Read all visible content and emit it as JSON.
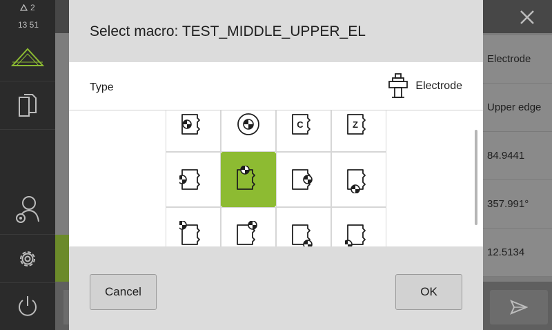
{
  "status": {
    "message_count": "2",
    "time": "13 51"
  },
  "sidebar": {
    "items": [
      {
        "name": "measure",
        "icon": "measure-triangle-icon"
      },
      {
        "name": "documents",
        "icon": "documents-icon"
      },
      {
        "name": "user",
        "icon": "user-settings-icon"
      },
      {
        "name": "settings",
        "icon": "gear-icon"
      },
      {
        "name": "power",
        "icon": "power-icon"
      }
    ]
  },
  "background": {
    "rows": [
      "Electrode",
      "Upper edge",
      "84.9441",
      "357.991°",
      "12.5134"
    ]
  },
  "dialog": {
    "title": "Select macro: TEST_MIDDLE_UPPER_EL",
    "type_label": "Type",
    "tool_label": "Electrode",
    "macros": [
      {
        "row": 0,
        "col": 0,
        "kind": "target-inside-left"
      },
      {
        "row": 0,
        "col": 1,
        "kind": "target-center"
      },
      {
        "row": 0,
        "col": 2,
        "kind": "text",
        "label": "C"
      },
      {
        "row": 0,
        "col": 3,
        "kind": "text",
        "label": "Z"
      },
      {
        "row": 1,
        "col": 0,
        "kind": "target-left-middle"
      },
      {
        "row": 1,
        "col": 1,
        "kind": "target-top-middle",
        "selected": true
      },
      {
        "row": 1,
        "col": 2,
        "kind": "target-right-middle"
      },
      {
        "row": 1,
        "col": 3,
        "kind": "target-bottom-left"
      },
      {
        "row": 2,
        "col": 0,
        "kind": "target-top-left"
      },
      {
        "row": 2,
        "col": 1,
        "kind": "target-top-right"
      },
      {
        "row": 2,
        "col": 2,
        "kind": "target-bottom-right"
      },
      {
        "row": 2,
        "col": 3,
        "kind": "target-bottom-left-corner"
      }
    ],
    "cancel_label": "Cancel",
    "ok_label": "OK"
  },
  "colors": {
    "accent": "#8dbb32",
    "sidebar": "#2b2b2b"
  }
}
